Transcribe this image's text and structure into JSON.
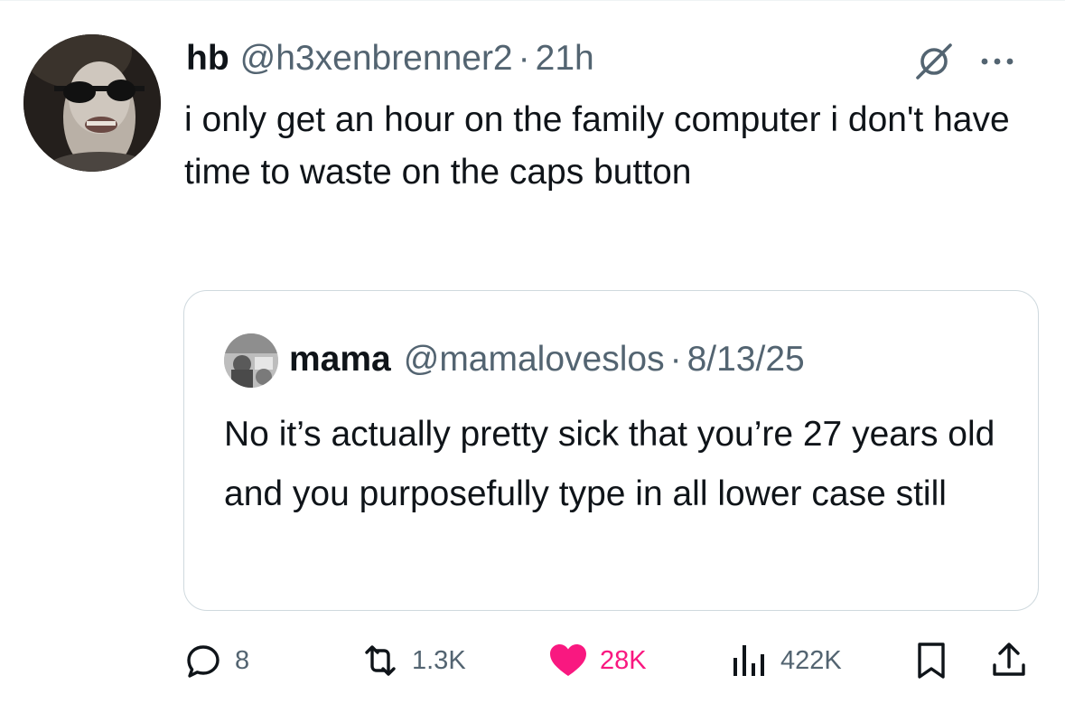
{
  "tweet": {
    "author_name": "hb",
    "author_handle": "@h3xenbrenner2",
    "separator": "·",
    "time": "21h",
    "text": "i only get an hour on the family computer i don't have time to waste on the caps button"
  },
  "quote": {
    "author_name": "mama",
    "author_handle": "@mamaloveslos",
    "separator": "·",
    "date": "8/13/25",
    "text": "No it’s actually pretty sick that you’re 27 years old and you purposefully type in all lower case still"
  },
  "actions": {
    "replies": "8",
    "reposts": "1.3K",
    "likes": "28K",
    "views": "422K"
  },
  "icons": {
    "reply": "reply-icon",
    "repost": "repost-icon",
    "like": "heart-icon",
    "views": "views-icon",
    "bookmark": "bookmark-icon",
    "share": "share-icon",
    "grok": "grok-icon",
    "more": "more-icon"
  },
  "colors": {
    "text": "#0f1419",
    "secondary": "#536471",
    "like": "#f91880",
    "border": "#cfd9de"
  }
}
